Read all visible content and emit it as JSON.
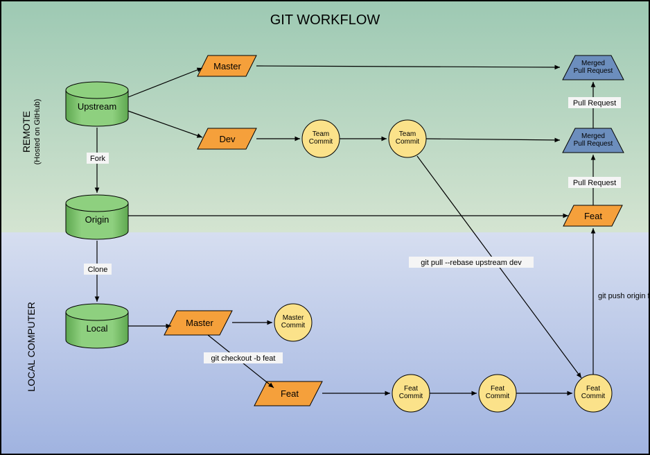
{
  "title": "GIT WORKFLOW",
  "sections": {
    "remote": {
      "label": "REMOTE",
      "sublabel": "(Hosted on GitHub)"
    },
    "local": {
      "label": "LOCAL COMPUTER"
    }
  },
  "nodes": {
    "upstream": "Upstream",
    "origin": "Origin",
    "local": "Local",
    "master_remote": "Master",
    "dev_remote": "Dev",
    "master_local": "Master",
    "feat_local": "Feat",
    "feat_origin": "Feat",
    "team_commit_1": "Team\nCommit",
    "team_commit_2": "Team\nCommit",
    "master_commit": "Master\nCommit",
    "feat_commit_1": "Feat\nCommit",
    "feat_commit_2": "Feat\nCommit",
    "feat_commit_3": "Feat\nCommit",
    "merged_pr_top": "Merged\nPull Request",
    "merged_pr_bottom": "Merged\nPull Request"
  },
  "edges": {
    "fork": "Fork",
    "clone": "Clone",
    "checkout": "git checkout -b feat",
    "rebase": "git pull --rebase upstream dev",
    "push": "git push origin feat",
    "pull_request_top": "Pull Request",
    "pull_request_bottom": "Pull Request"
  },
  "colors": {
    "green": "#7BC66F",
    "orange": "#F5A03B",
    "yellow": "#FBE28A",
    "blue": "#6C8EBD",
    "labelbg": "#F5F5F5"
  }
}
